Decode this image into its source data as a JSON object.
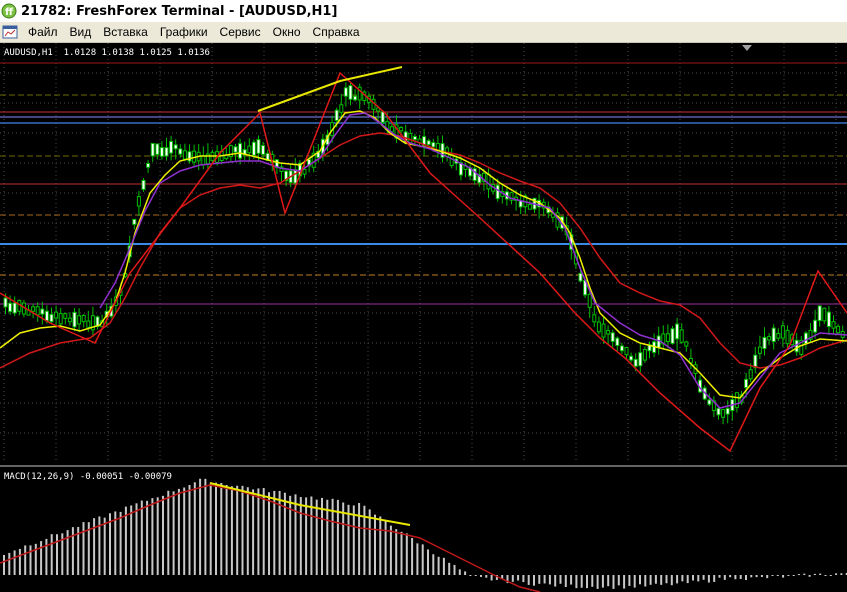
{
  "window": {
    "title": "21782: FreshForex Terminal - [AUDUSD,H1]"
  },
  "menu": {
    "items": [
      "Файл",
      "Вид",
      "Вставка",
      "Графики",
      "Сервис",
      "Окно",
      "Справка"
    ]
  },
  "chart": {
    "header": "AUDUSD,H1  1.0128 1.0138 1.0125 1.0136",
    "indicator_header": "MACD(12,26,9) -0.00051 -0.00079",
    "colors": {
      "background": "#000000",
      "grid": "#5a5a5a",
      "bull": "#00c000",
      "bear": "#00c000",
      "separator": "#c8c8c8"
    }
  }
}
